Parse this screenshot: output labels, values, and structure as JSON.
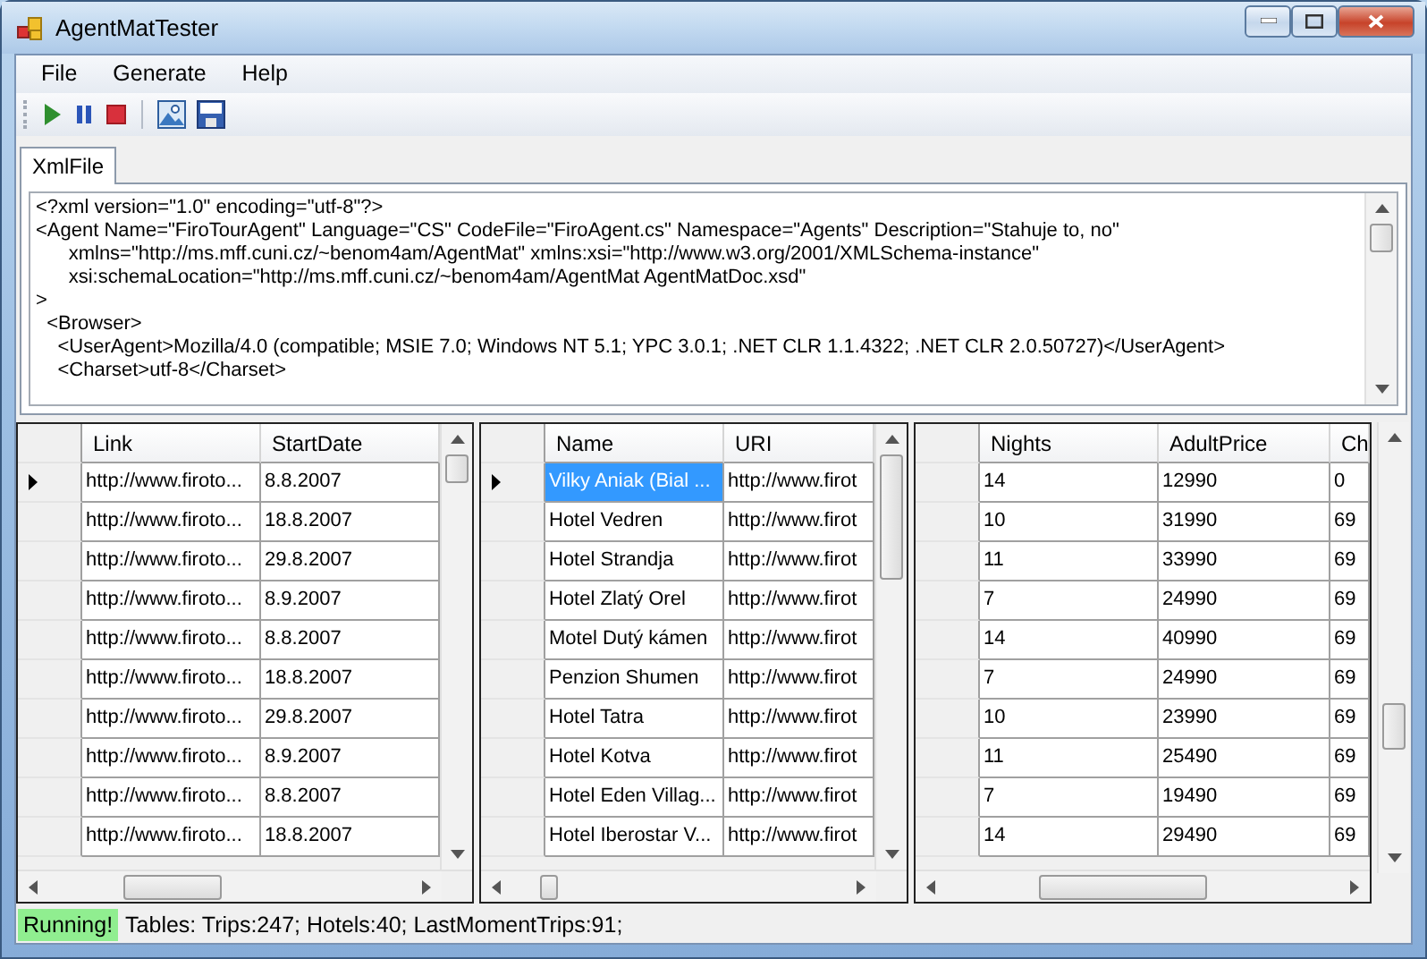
{
  "window": {
    "title": "AgentMatTester"
  },
  "menu": [
    "File",
    "Generate",
    "Help"
  ],
  "tabs": [
    {
      "label": "XmlFile",
      "selected": true
    }
  ],
  "xml_lines": [
    "<?xml version=\"1.0\" encoding=\"utf-8\"?>",
    "<Agent Name=\"FiroTourAgent\" Language=\"CS\" CodeFile=\"FiroAgent.cs\" Namespace=\"Agents\" Description=\"Stahuje to, no\"",
    "      xmlns=\"http://ms.mff.cuni.cz/~benom4am/AgentMat\" xmlns:xsi=\"http://www.w3.org/2001/XMLSchema-instance\"",
    "      xsi:schemaLocation=\"http://ms.mff.cuni.cz/~benom4am/AgentMat AgentMatDoc.xsd\"",
    ">",
    "  <Browser>",
    "    <UserAgent>Mozilla/4.0 (compatible; MSIE 7.0; Windows NT 5.1; YPC 3.0.1; .NET CLR 1.1.4322; .NET CLR 2.0.50727)</UserAgent>",
    "    <Charset>utf-8</Charset>"
  ],
  "grids": [
    {
      "columns": [
        "Link",
        "StartDate"
      ],
      "rows": [
        {
          "current": true,
          "cells": [
            {
              "text": "http://www.firoto...",
              "selected": false
            },
            {
              "text": "8.8.2007",
              "selected": false
            }
          ]
        },
        {
          "current": false,
          "cells": [
            {
              "text": "http://www.firoto...",
              "selected": false
            },
            {
              "text": "18.8.2007",
              "selected": false
            }
          ]
        },
        {
          "current": false,
          "cells": [
            {
              "text": "http://www.firoto...",
              "selected": false
            },
            {
              "text": "29.8.2007",
              "selected": false
            }
          ]
        },
        {
          "current": false,
          "cells": [
            {
              "text": "http://www.firoto...",
              "selected": false
            },
            {
              "text": "8.9.2007",
              "selected": false
            }
          ]
        },
        {
          "current": false,
          "cells": [
            {
              "text": "http://www.firoto...",
              "selected": false
            },
            {
              "text": "8.8.2007",
              "selected": false
            }
          ]
        },
        {
          "current": false,
          "cells": [
            {
              "text": "http://www.firoto...",
              "selected": false
            },
            {
              "text": "18.8.2007",
              "selected": false
            }
          ]
        },
        {
          "current": false,
          "cells": [
            {
              "text": "http://www.firoto...",
              "selected": false
            },
            {
              "text": "29.8.2007",
              "selected": false
            }
          ]
        },
        {
          "current": false,
          "cells": [
            {
              "text": "http://www.firoto...",
              "selected": false
            },
            {
              "text": "8.9.2007",
              "selected": false
            }
          ]
        },
        {
          "current": false,
          "cells": [
            {
              "text": "http://www.firoto...",
              "selected": false
            },
            {
              "text": "8.8.2007",
              "selected": false
            }
          ]
        },
        {
          "current": false,
          "cells": [
            {
              "text": "http://www.firoto...",
              "selected": false
            },
            {
              "text": "18.8.2007",
              "selected": false
            }
          ]
        }
      ]
    },
    {
      "columns": [
        "Name",
        "URI"
      ],
      "rows": [
        {
          "current": true,
          "cells": [
            {
              "text": "Vilky Aniak (Bial ...",
              "selected": true
            },
            {
              "text": "http://www.firot",
              "selected": false
            }
          ]
        },
        {
          "current": false,
          "cells": [
            {
              "text": "Hotel Vedren",
              "selected": false
            },
            {
              "text": "http://www.firot",
              "selected": false
            }
          ]
        },
        {
          "current": false,
          "cells": [
            {
              "text": "Hotel Strandja",
              "selected": false
            },
            {
              "text": "http://www.firot",
              "selected": false
            }
          ]
        },
        {
          "current": false,
          "cells": [
            {
              "text": "Hotel Zlatý Orel",
              "selected": false
            },
            {
              "text": "http://www.firot",
              "selected": false
            }
          ]
        },
        {
          "current": false,
          "cells": [
            {
              "text": "Motel Dutý kámen",
              "selected": false
            },
            {
              "text": "http://www.firot",
              "selected": false
            }
          ]
        },
        {
          "current": false,
          "cells": [
            {
              "text": "Penzion Shumen",
              "selected": false
            },
            {
              "text": "http://www.firot",
              "selected": false
            }
          ]
        },
        {
          "current": false,
          "cells": [
            {
              "text": "Hotel Tatra",
              "selected": false
            },
            {
              "text": "http://www.firot",
              "selected": false
            }
          ]
        },
        {
          "current": false,
          "cells": [
            {
              "text": "Hotel Kotva",
              "selected": false
            },
            {
              "text": "http://www.firot",
              "selected": false
            }
          ]
        },
        {
          "current": false,
          "cells": [
            {
              "text": "Hotel Eden Villag...",
              "selected": false
            },
            {
              "text": "http://www.firot",
              "selected": false
            }
          ]
        },
        {
          "current": false,
          "cells": [
            {
              "text": "Hotel Iberostar V...",
              "selected": false
            },
            {
              "text": "http://www.firot",
              "selected": false
            }
          ]
        }
      ]
    },
    {
      "columns": [
        "Nights",
        "AdultPrice",
        "Ch"
      ],
      "rows": [
        {
          "current": false,
          "cells": [
            {
              "text": "14",
              "selected": false
            },
            {
              "text": "12990",
              "selected": false
            },
            {
              "text": "0",
              "selected": false
            }
          ]
        },
        {
          "current": false,
          "cells": [
            {
              "text": "10",
              "selected": false
            },
            {
              "text": "31990",
              "selected": false
            },
            {
              "text": "69",
              "selected": false
            }
          ]
        },
        {
          "current": false,
          "cells": [
            {
              "text": "11",
              "selected": false
            },
            {
              "text": "33990",
              "selected": false
            },
            {
              "text": "69",
              "selected": false
            }
          ]
        },
        {
          "current": false,
          "cells": [
            {
              "text": "7",
              "selected": false
            },
            {
              "text": "24990",
              "selected": false
            },
            {
              "text": "69",
              "selected": false
            }
          ]
        },
        {
          "current": false,
          "cells": [
            {
              "text": "14",
              "selected": false
            },
            {
              "text": "40990",
              "selected": false
            },
            {
              "text": "69",
              "selected": false
            }
          ]
        },
        {
          "current": false,
          "cells": [
            {
              "text": "7",
              "selected": false
            },
            {
              "text": "24990",
              "selected": false
            },
            {
              "text": "69",
              "selected": false
            }
          ]
        },
        {
          "current": false,
          "cells": [
            {
              "text": "10",
              "selected": false
            },
            {
              "text": "23990",
              "selected": false
            },
            {
              "text": "69",
              "selected": false
            }
          ]
        },
        {
          "current": false,
          "cells": [
            {
              "text": "11",
              "selected": false
            },
            {
              "text": "25490",
              "selected": false
            },
            {
              "text": "69",
              "selected": false
            }
          ]
        },
        {
          "current": false,
          "cells": [
            {
              "text": "7",
              "selected": false
            },
            {
              "text": "19490",
              "selected": false
            },
            {
              "text": "69",
              "selected": false
            }
          ]
        },
        {
          "current": false,
          "cells": [
            {
              "text": "14",
              "selected": false
            },
            {
              "text": "29490",
              "selected": false
            },
            {
              "text": "69",
              "selected": false
            }
          ]
        }
      ]
    }
  ],
  "status_bar": {
    "state": "Running!",
    "text": "Tables: Trips:247; Hotels:40; LastMomentTrips:91;"
  }
}
